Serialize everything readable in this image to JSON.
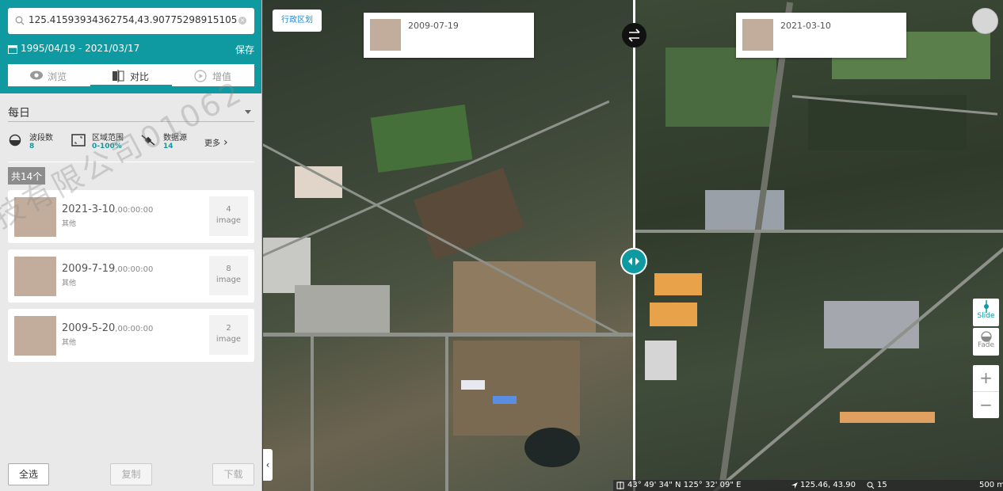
{
  "search": {
    "query": "125.41593934362754,43.90775298915105"
  },
  "date_range": {
    "label": "1995/04/19 - 2021/03/17",
    "save_label": "保存"
  },
  "tabs": [
    {
      "label": "浏览",
      "icon": "eye-icon",
      "active": false
    },
    {
      "label": "对比",
      "icon": "compare-icon",
      "active": true
    },
    {
      "label": "增值",
      "icon": "play-circle-icon",
      "active": false
    }
  ],
  "frequency": {
    "value": "每日"
  },
  "stats": [
    {
      "label": "波段数",
      "value": "8",
      "icon": "half-circle-icon"
    },
    {
      "label": "区域范围",
      "value": "0-100%",
      "icon": "area-frame-icon"
    },
    {
      "label": "数据源",
      "value": "14",
      "icon": "satellite-icon"
    }
  ],
  "more_label": "更多",
  "result_count": "共14个",
  "images": [
    {
      "date": "2021-3-10",
      "time": ",00:00:00",
      "source": "其他",
      "count": "4",
      "unit": "image"
    },
    {
      "date": "2009-7-19",
      "time": ",00:00:00",
      "source": "其他",
      "count": "8",
      "unit": "image"
    },
    {
      "date": "2009-5-20",
      "time": ",00:00:00",
      "source": "其他",
      "count": "2",
      "unit": "image"
    }
  ],
  "footer": {
    "select_all": "全选",
    "copy": "复制",
    "download": "下载"
  },
  "watermark": "技有限公司01062",
  "map": {
    "admin_label": "行政区划",
    "left_date": "2009-07-19",
    "right_date": "2021-03-10",
    "slide_label": "Slide",
    "fade_label": "Fade",
    "zoom_in": "+",
    "zoom_out": "−",
    "status": {
      "dms": "43° 49' 34\" N 125° 32' 09\" E",
      "lnglat": "125.46, 43.90",
      "zoom": "15",
      "scale": "500 m"
    }
  },
  "colors": {
    "accent": "#0e9aa0",
    "link": "#1a8de0",
    "thumb": "#c2ad9c"
  }
}
